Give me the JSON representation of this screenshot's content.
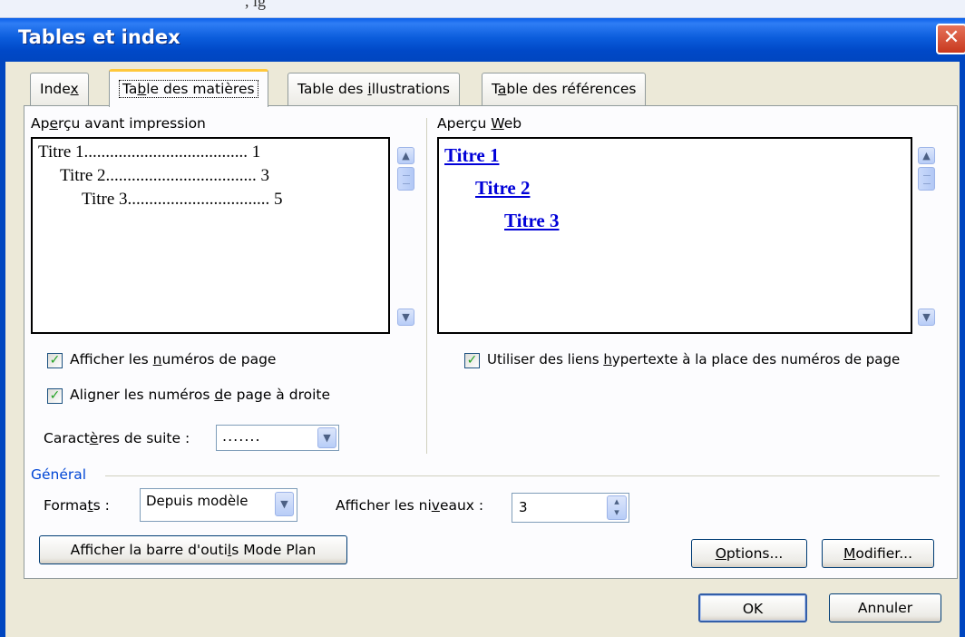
{
  "window": {
    "title": "Tables et index",
    "close_glyph": "✕",
    "background_fragment": ", ig"
  },
  "tabs": [
    {
      "label_parts": [
        "Inde",
        "x",
        ""
      ],
      "selected": false
    },
    {
      "label_parts": [
        "Ta",
        "b",
        "le des matières"
      ],
      "selected": true
    },
    {
      "label_parts": [
        "Table des ",
        "i",
        "llustrations"
      ],
      "selected": false
    },
    {
      "label_parts": [
        "T",
        "a",
        "ble des références"
      ],
      "selected": false
    }
  ],
  "print_preview": {
    "label_parts": [
      "Ap",
      "e",
      "rçu avant impression"
    ],
    "lines": [
      {
        "text": "Titre 1",
        "dots": "......................................",
        "page": "1"
      },
      {
        "text": "Titre 2",
        "dots": "...................................",
        "page": "3"
      },
      {
        "text": "Titre 3",
        "dots": ".................................",
        "page": "5"
      }
    ]
  },
  "web_preview": {
    "label_parts": [
      "Aperçu ",
      "W",
      "eb"
    ],
    "links": [
      "Titre 1",
      "Titre 2",
      "Titre 3"
    ]
  },
  "options": {
    "show_page_numbers": {
      "label_parts": [
        "Afficher les ",
        "n",
        "uméros de page"
      ],
      "checked": true
    },
    "align_right": {
      "label_parts": [
        "Aligner les numéros ",
        "d",
        "e page à droite"
      ],
      "checked": true
    },
    "hyperlinks": {
      "label_parts": [
        "Utiliser des liens ",
        "h",
        "ypertexte à la place des numéros de page"
      ],
      "checked": true
    },
    "tab_leader": {
      "label_parts": [
        "Caract",
        "è",
        "res de suite :"
      ],
      "value": "......."
    }
  },
  "general": {
    "group_label": "Général",
    "formats": {
      "label_parts": [
        "Forma",
        "t",
        "s :"
      ],
      "value": "Depuis modèle"
    },
    "levels": {
      "label_parts": [
        "Afficher les ni",
        "v",
        "eaux :"
      ],
      "value": "3"
    }
  },
  "buttons": {
    "outline_toolbar": {
      "label_parts": [
        "Afficher la barre d'outi",
        "l",
        "s Mode Plan"
      ]
    },
    "options": {
      "label_parts": [
        "",
        "O",
        "ptions..."
      ]
    },
    "modify": {
      "label_parts": [
        "",
        "M",
        "odifier..."
      ]
    },
    "ok": "OK",
    "cancel": "Annuler"
  },
  "glyphs": {
    "check": "✓",
    "up": "▲",
    "down": "▼",
    "spin_up": "▴",
    "spin_down": "▾"
  }
}
